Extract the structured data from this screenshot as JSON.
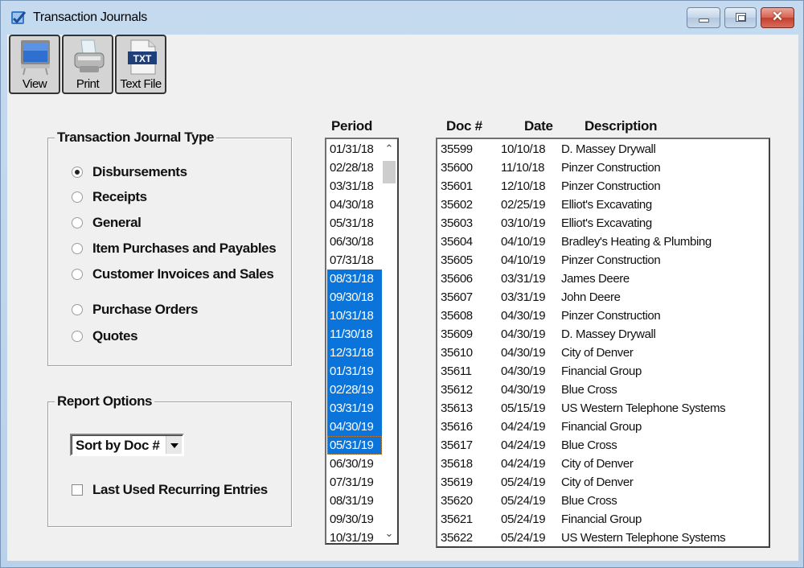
{
  "window": {
    "title": "Transaction Journals",
    "controls": {
      "minimize": "minimize",
      "maximize": "maximize",
      "close": "✕"
    }
  },
  "toolbar": {
    "view_label": "View",
    "print_label": "Print",
    "textfile_label": "Text File",
    "txt_badge": "TXT"
  },
  "journal_type": {
    "title": "Transaction Journal Type",
    "selected": "Disbursements",
    "options": [
      "Disbursements",
      "Receipts",
      "General",
      "Item Purchases and Payables",
      "Customer Invoices and Sales",
      "Purchase Orders",
      "Quotes"
    ]
  },
  "report_options": {
    "title": "Report Options",
    "sort_value": "Sort by Doc #",
    "last_used_label": "Last Used Recurring Entries",
    "last_used_checked": false
  },
  "period": {
    "header": "Period",
    "items": [
      {
        "label": "01/31/18",
        "selected": false
      },
      {
        "label": "02/28/18",
        "selected": false
      },
      {
        "label": "03/31/18",
        "selected": false
      },
      {
        "label": "04/30/18",
        "selected": false
      },
      {
        "label": "05/31/18",
        "selected": false
      },
      {
        "label": "06/30/18",
        "selected": false
      },
      {
        "label": "07/31/18",
        "selected": false
      },
      {
        "label": "08/31/18",
        "selected": true
      },
      {
        "label": "09/30/18",
        "selected": true
      },
      {
        "label": "10/31/18",
        "selected": true
      },
      {
        "label": "11/30/18",
        "selected": true
      },
      {
        "label": "12/31/18",
        "selected": true
      },
      {
        "label": "01/31/19",
        "selected": true
      },
      {
        "label": "02/28/19",
        "selected": true
      },
      {
        "label": "03/31/19",
        "selected": true
      },
      {
        "label": "04/30/19",
        "selected": true
      },
      {
        "label": "05/31/19",
        "selected": true,
        "focused": true
      },
      {
        "label": "06/30/19",
        "selected": false
      },
      {
        "label": "07/31/19",
        "selected": false
      },
      {
        "label": "08/31/19",
        "selected": false
      },
      {
        "label": "09/30/19",
        "selected": false
      },
      {
        "label": "10/31/19",
        "selected": false
      }
    ]
  },
  "documents": {
    "headers": {
      "doc": "Doc #",
      "date": "Date",
      "description": "Description"
    },
    "rows": [
      {
        "doc": "35599",
        "date": "10/10/18",
        "description": "D. Massey Drywall"
      },
      {
        "doc": "35600",
        "date": "11/10/18",
        "description": "Pinzer Construction"
      },
      {
        "doc": "35601",
        "date": "12/10/18",
        "description": "Pinzer Construction"
      },
      {
        "doc": "35602",
        "date": "02/25/19",
        "description": "Elliot's Excavating"
      },
      {
        "doc": "35603",
        "date": "03/10/19",
        "description": "Elliot's Excavating"
      },
      {
        "doc": "35604",
        "date": "04/10/19",
        "description": "Bradley's Heating & Plumbing"
      },
      {
        "doc": "35605",
        "date": "04/10/19",
        "description": "Pinzer Construction"
      },
      {
        "doc": "35606",
        "date": "03/31/19",
        "description": "James Deere"
      },
      {
        "doc": "35607",
        "date": "03/31/19",
        "description": "John Deere"
      },
      {
        "doc": "35608",
        "date": "04/30/19",
        "description": "Pinzer Construction"
      },
      {
        "doc": "35609",
        "date": "04/30/19",
        "description": "D. Massey Drywall"
      },
      {
        "doc": "35610",
        "date": "04/30/19",
        "description": "City of Denver"
      },
      {
        "doc": "35611",
        "date": "04/30/19",
        "description": "Financial Group"
      },
      {
        "doc": "35612",
        "date": "04/30/19",
        "description": "Blue Cross"
      },
      {
        "doc": "35613",
        "date": "05/15/19",
        "description": "US Western Telephone Systems"
      },
      {
        "doc": "35616",
        "date": "04/24/19",
        "description": "Financial Group"
      },
      {
        "doc": "35617",
        "date": "04/24/19",
        "description": "Blue Cross"
      },
      {
        "doc": "35618",
        "date": "04/24/19",
        "description": "City of Denver"
      },
      {
        "doc": "35619",
        "date": "05/24/19",
        "description": "City of Denver"
      },
      {
        "doc": "35620",
        "date": "05/24/19",
        "description": "Blue Cross"
      },
      {
        "doc": "35621",
        "date": "05/24/19",
        "description": "Financial Group"
      },
      {
        "doc": "35622",
        "date": "05/24/19",
        "description": "US Western Telephone Systems"
      }
    ]
  },
  "colors": {
    "selection": "#0a74da",
    "client_bg": "#f0f0f0",
    "frame": "#b9d1ea",
    "close_button": "#c9503c"
  }
}
